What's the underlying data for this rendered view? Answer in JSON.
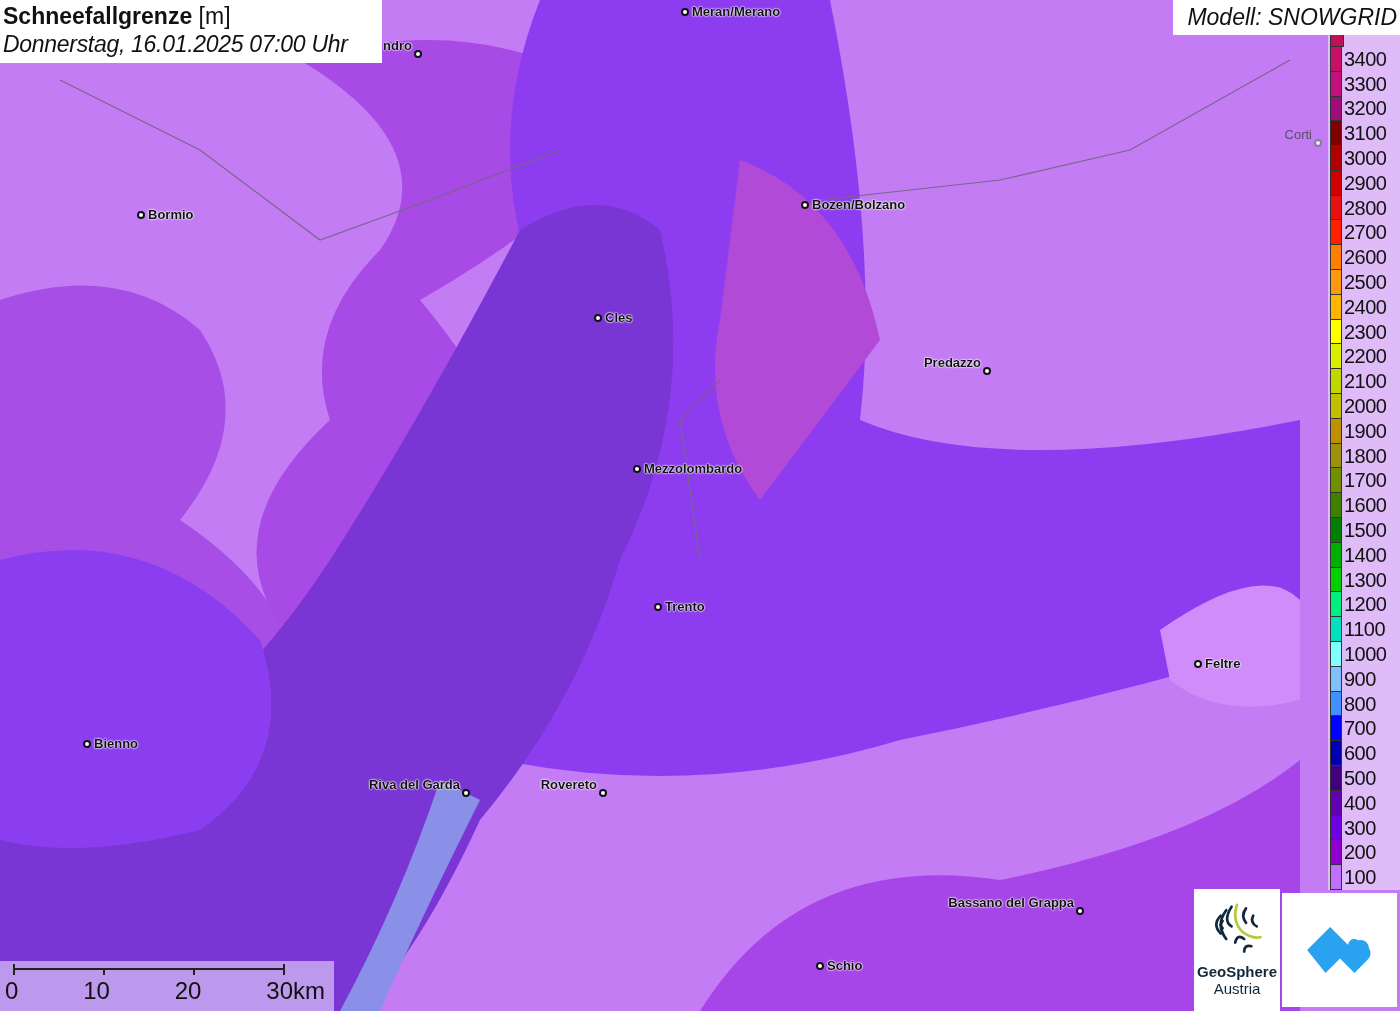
{
  "title": "**Schneefallgrenze** [m]",
  "timestamp": "Donnerstag, 16.01.2025 07:00 Uhr",
  "model": "Modell: SNOWGRID",
  "legend": [
    {
      "value": "3400",
      "color": "#c8106a"
    },
    {
      "value": "3300",
      "color": "#c4107c"
    },
    {
      "value": "3200",
      "color": "#a00c78"
    },
    {
      "value": "3100",
      "color": "#800000"
    },
    {
      "value": "3000",
      "color": "#b00000"
    },
    {
      "value": "2900",
      "color": "#d00000"
    },
    {
      "value": "2800",
      "color": "#e81010"
    },
    {
      "value": "2700",
      "color": "#ff2000"
    },
    {
      "value": "2600",
      "color": "#ff8000"
    },
    {
      "value": "2500",
      "color": "#ff9a10"
    },
    {
      "value": "2400",
      "color": "#ffb400"
    },
    {
      "value": "2300",
      "color": "#ffff00"
    },
    {
      "value": "2200",
      "color": "#d8f000"
    },
    {
      "value": "2100",
      "color": "#c0d800"
    },
    {
      "value": "2000",
      "color": "#c0c000"
    },
    {
      "value": "1900",
      "color": "#c09000"
    },
    {
      "value": "1800",
      "color": "#a09010"
    },
    {
      "value": "1700",
      "color": "#709000"
    },
    {
      "value": "1600",
      "color": "#408000"
    },
    {
      "value": "1500",
      "color": "#008000"
    },
    {
      "value": "1400",
      "color": "#00b000"
    },
    {
      "value": "1300",
      "color": "#00d000"
    },
    {
      "value": "1200",
      "color": "#00f080"
    },
    {
      "value": "1100",
      "color": "#00e0c0"
    },
    {
      "value": "1000",
      "color": "#80ffff"
    },
    {
      "value": "900",
      "color": "#80c0ff"
    },
    {
      "value": "800",
      "color": "#4090ff"
    },
    {
      "value": "700",
      "color": "#0000ff"
    },
    {
      "value": "600",
      "color": "#0000b0"
    },
    {
      "value": "500",
      "color": "#400080"
    },
    {
      "value": "400",
      "color": "#6000b0"
    },
    {
      "value": "300",
      "color": "#7000e0"
    },
    {
      "value": "200",
      "color": "#9000d0"
    },
    {
      "value": "100",
      "color": "#c070ff"
    }
  ],
  "cities": [
    {
      "name": "Meran/Merano",
      "faded": false
    },
    {
      "name": "ndro",
      "faded": false
    },
    {
      "name": "Bormio",
      "faded": false
    },
    {
      "name": "Bozen/Bolzano",
      "faded": false
    },
    {
      "name": "Corti",
      "faded": true
    },
    {
      "name": "Cles",
      "faded": false
    },
    {
      "name": "Predazzo",
      "faded": false
    },
    {
      "name": "Mezzolombardo",
      "faded": false
    },
    {
      "name": "Trento",
      "faded": false
    },
    {
      "name": "Feltre",
      "faded": false
    },
    {
      "name": "Bienno",
      "faded": false
    },
    {
      "name": "Riva del Garda",
      "faded": false
    },
    {
      "name": "Rovereto",
      "faded": false
    },
    {
      "name": "Bassano del Grappa",
      "faded": false
    },
    {
      "name": "Schio",
      "faded": false
    }
  ],
  "scale_bar": [
    "0",
    "10",
    "20",
    "30km"
  ],
  "logo": {
    "name": "GeoSphere",
    "sub": "Austria"
  }
}
